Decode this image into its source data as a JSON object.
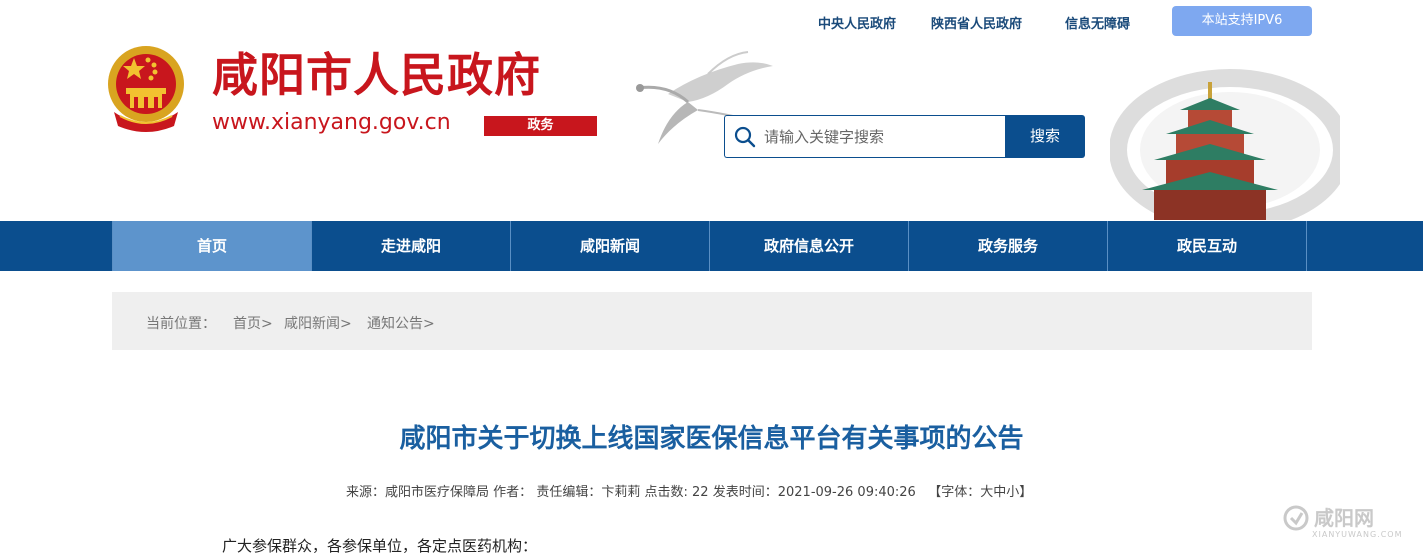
{
  "top_links": [
    "中央人民政府",
    "陕西省人民政府",
    "信息无障碍"
  ],
  "ipv6_label": "本站支持IPV6",
  "logo": {
    "title": "咸阳市人民政府",
    "url": "www.xianyang.gov.cn",
    "tag": "政务"
  },
  "search": {
    "placeholder": "请输入关键字搜索",
    "button_label": "搜索"
  },
  "nav": {
    "items": [
      "首页",
      "走进咸阳",
      "咸阳新闻",
      "政府信息公开",
      "政务服务",
      "政民互动"
    ],
    "active_index": 0
  },
  "breadcrumb": {
    "prefix": "当前位置：",
    "items": [
      "首页>",
      "咸阳新闻>",
      "通知公告>"
    ]
  },
  "article": {
    "title": "咸阳市关于切换上线国家医保信息平台有关事项的公告",
    "source_label": "来源：",
    "source": "咸阳市医疗保障局",
    "author_label": "作者：",
    "editor_label": "责任编辑：",
    "editor": "卞莉莉",
    "clicks_label": "点击数:",
    "clicks": "22",
    "time_label": "发表时间：",
    "time": "2021-09-26 09:40:26",
    "font_label": "【字体：",
    "font_options": [
      "大",
      "中",
      "小"
    ],
    "font_close": "】",
    "first_line": "广大参保群众，各参保单位，各定点医药机构："
  },
  "watermark": {
    "name": "咸阳网",
    "url": "XIANYUWANG.COM"
  },
  "colors": {
    "brand_red": "#c8161d",
    "nav_blue": "#0b4e8e",
    "nav_active": "#5d94cc",
    "title_blue": "#1a5fa0"
  }
}
